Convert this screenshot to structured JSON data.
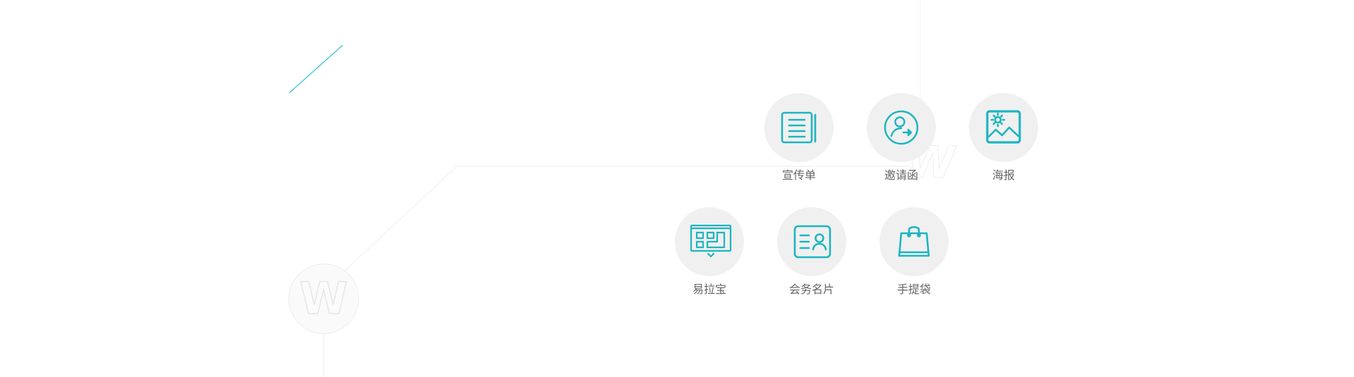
{
  "colors": {
    "accent": "#1cb5c1",
    "circle_bg": "#f0f0f0",
    "label_text": "#666666",
    "deco_line": "#eeeeee",
    "accent_line": "#36c3cf"
  },
  "logo": {
    "letter": "W"
  },
  "services": [
    {
      "label": "宣传单",
      "icon": "flyer-document-icon"
    },
    {
      "label": "邀请函",
      "icon": "invitation-person-icon"
    },
    {
      "label": "海报",
      "icon": "poster-image-icon"
    },
    {
      "label": "易拉宝",
      "icon": "rollup-banner-icon"
    },
    {
      "label": "会务名片",
      "icon": "business-card-icon"
    },
    {
      "label": "手提袋",
      "icon": "shopping-bag-icon"
    }
  ]
}
